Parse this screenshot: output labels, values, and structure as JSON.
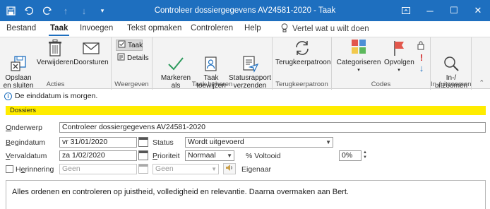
{
  "window": {
    "title": "Controleer dossiergegevens AV24581-2020  -  Taak",
    "accent": "#1e6fbf"
  },
  "qat": {
    "save_icon": "save-icon",
    "undo_icon": "undo-icon",
    "redo_icon": "redo-icon"
  },
  "tabs": [
    {
      "label": "Bestand"
    },
    {
      "label": "Taak"
    },
    {
      "label": "Invoegen"
    },
    {
      "label": "Tekst opmaken"
    },
    {
      "label": "Controleren"
    },
    {
      "label": "Help"
    }
  ],
  "tellme": "Vertel wat u wilt doen",
  "ribbon": {
    "acties": {
      "label": "Acties",
      "save_close": "Opslaan\nen sluiten",
      "delete": "Verwijderen",
      "forward": "Doorsturen"
    },
    "weergeven": {
      "label": "Weergeven",
      "task": "Taak",
      "details": "Details"
    },
    "taak_beheren": {
      "label": "Taak beheren",
      "mark_complete": "Markeren\nals voltooid",
      "assign": "Taak\ntoewijzen",
      "status_report": "Statusrapport\nverzenden"
    },
    "terugkeerpatroon": {
      "label": "Terugkeerpatroon",
      "recurrence": "Terugkeerpatroon"
    },
    "codes": {
      "label": "Codes",
      "categorize": "Categoriseren",
      "followup": "Opvolgen"
    },
    "zoom": {
      "label": "In-/uitzoomen",
      "zoom": "In-/\nuitzoomen"
    }
  },
  "info": "De einddatum is morgen.",
  "category": "Dossiers",
  "category_color": "#ffec00",
  "form": {
    "subject_label": "Onderwerp",
    "subject_value": "Controleer dossiergegevens AV24581-2020",
    "start_label": "Begindatum",
    "start_value": "vr 31/01/2020",
    "due_label": "Vervaldatum",
    "due_value": "za 1/02/2020",
    "status_label": "Status",
    "status_value": "Wordt uitgevoerd",
    "priority_label": "Prioriteit",
    "priority_value": "Normaal",
    "percent_label": "% Voltooid",
    "percent_value": "0%",
    "reminder_label": "Herinnering",
    "reminder_date": "Geen",
    "reminder_time": "Geen",
    "owner_label": "Eigenaar"
  },
  "notes": "Alles  ordenen en controleren op juistheid, volledigheid en relevantie. Daarna overmaken aan Bert."
}
